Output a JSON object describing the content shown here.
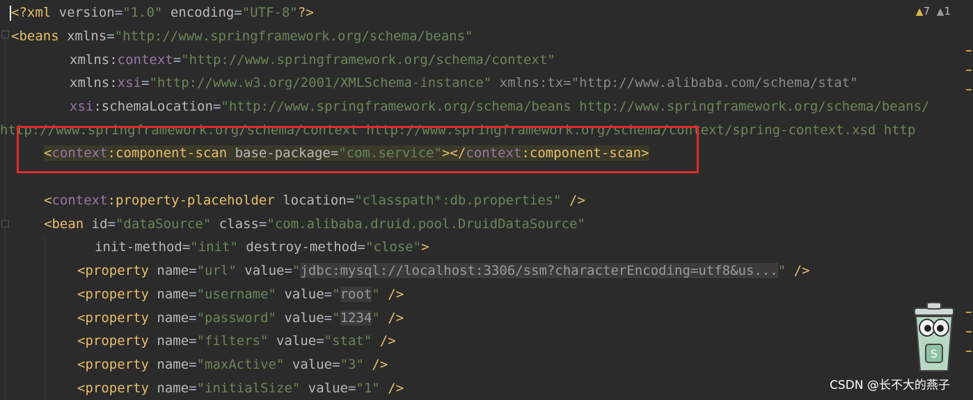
{
  "editor": {
    "lines": {
      "l1": {
        "open": "<?xml ",
        "version_attr": "version",
        "version_val": "\"1.0\"",
        "enc_attr": "encoding",
        "enc_val": "\"UTF-8\"",
        "close": "?>"
      },
      "l2": {
        "open": "<beans ",
        "attr": "xmlns",
        "val": "\"http://www.springframework.org/schema/beans\""
      },
      "l3": {
        "prefix": "xmlns",
        "ns": "context",
        "val": "\"http://www.springframework.org/schema/context\""
      },
      "l4": {
        "prefix": "xmlns",
        "ns": "xsi",
        "val": "\"http://www.w3.org/2001/XMLSchema-instance\"",
        "extra": " xmlns:tx=\"http://www.alibaba.com/schema/stat\""
      },
      "l5": {
        "ns": "xsi",
        "attr": "schemaLocation",
        "val": "\"http://www.springframework.org/schema/beans http://www.springframework.org/schema/beans/"
      },
      "l6": {
        "text": "http://www.springframework.org/schema/context http://www.springframework.org/schema/context/spring-context.xsd http"
      },
      "l7": {
        "lt": "<",
        "ns": "context",
        "tag": "component-scan",
        "attr": "base-package",
        "val": "\"com.service\"",
        "mid": "></",
        "ns2": "context",
        "tag2": "component-scan",
        "gt": ">"
      },
      "l9": {
        "lt": "<",
        "ns": "context",
        "tag": "property-placeholder",
        "attr": "location",
        "val": "\"classpath*:db.properties\"",
        "end": " />"
      },
      "l10": {
        "open": "<bean ",
        "id_attr": "id",
        "id_val": "\"dataSource\"",
        "class_attr": "class",
        "class_val": "\"com.alibaba.druid.pool.DruidDataSource\""
      },
      "l11": {
        "init_attr": "init-method",
        "init_val": "\"init\"",
        "destroy_attr": "destroy-method",
        "destroy_val": "\"close\"",
        "gt": ">"
      },
      "properties": [
        {
          "name": "\"url\"",
          "value_prefix": "\"",
          "value_folded": "jdbc:mysql://localhost:3306/ssm?characterEncoding=utf8&us...",
          "value_suffix": "\""
        },
        {
          "name": "\"username\"",
          "value_prefix": "\"",
          "value_folded": "root",
          "value_suffix": "\""
        },
        {
          "name": "\"password\"",
          "value_prefix": "\"",
          "value_folded": "1234",
          "value_suffix": "\""
        },
        {
          "name": "\"filters\"",
          "value": "\"stat\""
        },
        {
          "name": "\"maxActive\"",
          "value": "\"3\""
        },
        {
          "name": "\"initialSize\"",
          "value": "\"1\""
        }
      ]
    },
    "property_tag": "<property ",
    "name_attr": "name",
    "value_attr": "value",
    "self_close": " />"
  },
  "inspection": {
    "warnings": "7",
    "weak_warnings": "1",
    "warning_icon": "warning-triangle-icon",
    "weak_icon": "weak-warning-icon"
  },
  "watermark": "CSDN @长不大的燕子",
  "colors": {
    "background": "#2b2b2b",
    "tag": "#e8bf6a",
    "string": "#6a8759",
    "namespace": "#9876aa",
    "highlight_border": "#e02b2b"
  }
}
